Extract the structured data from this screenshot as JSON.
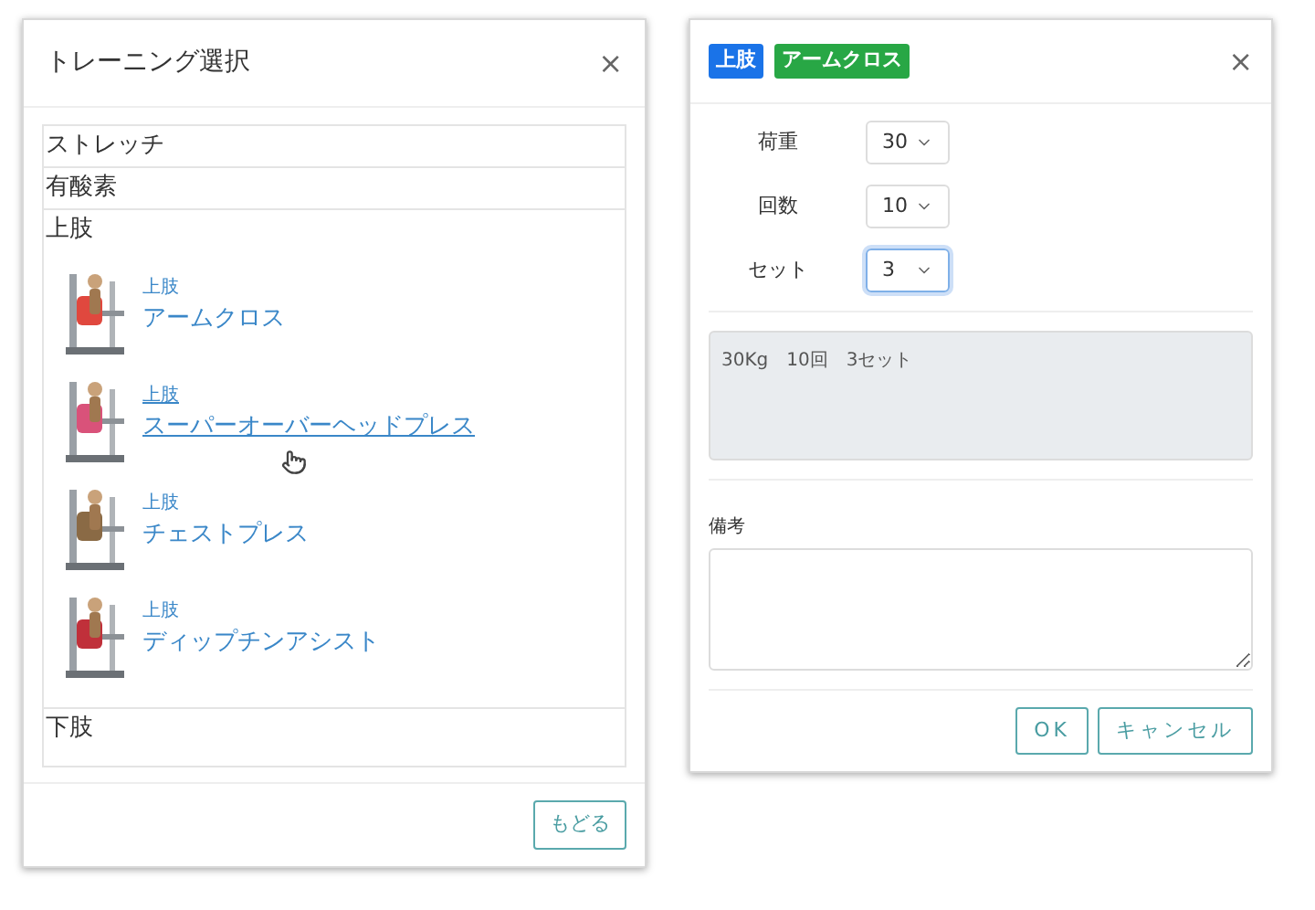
{
  "left_dialog": {
    "title": "トレーニング選択",
    "close": "×",
    "categories": [
      {
        "label": "ストレッチ"
      },
      {
        "label": "有酸素"
      },
      {
        "label": "上肢",
        "children": [
          {
            "category": "上肢",
            "name": "アームクロス",
            "hovered": false,
            "kind": "picture"
          },
          {
            "category": "上肢",
            "name": "スーパーオーバーヘッドプレス",
            "hovered": true,
            "kind": "picture"
          },
          {
            "category": "上肢",
            "name": "チェストプレス",
            "hovered": false,
            "kind": "picture"
          },
          {
            "category": "上肢",
            "name": "ディップチンアシスト",
            "hovered": false,
            "kind": "picture"
          }
        ]
      },
      {
        "label": "下肢"
      }
    ],
    "back_button": "もどる"
  },
  "right_dialog": {
    "badges": [
      {
        "text": "上肢",
        "color": "#1a73e8"
      },
      {
        "text": "アームクロス",
        "color": "#28a745"
      }
    ],
    "close": "×",
    "fields": [
      {
        "label": "荷重",
        "value": "30",
        "focused": false
      },
      {
        "label": "回数",
        "value": "10",
        "focused": false
      },
      {
        "label": "セット",
        "value": "3",
        "focused": true
      }
    ],
    "summary": "30Kg　10回　3セット",
    "notes_label": "備考",
    "buttons": [
      "OK",
      "キャンセル"
    ]
  }
}
